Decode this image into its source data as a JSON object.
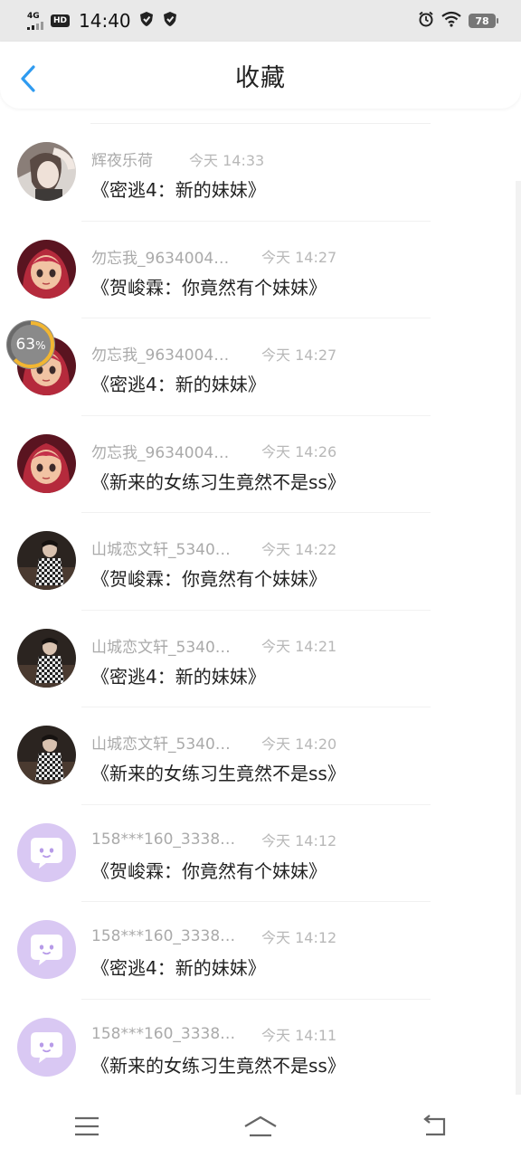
{
  "status_bar": {
    "network": "4G",
    "hd": "HD",
    "time": "14:40",
    "battery": "78"
  },
  "header": {
    "title": "收藏"
  },
  "progress_badge": {
    "value": "63",
    "unit": "%"
  },
  "items": [
    {
      "name": "辉夜乐荷",
      "time": "今天 14:33",
      "title": "《密逃4：新的妹妹》",
      "avatar": "photo-girl"
    },
    {
      "name": "勿忘我_9634004…",
      "time": "今天 14:27",
      "title": "《贺峻霖：你竟然有个妹妹》",
      "avatar": "anime-red-hair"
    },
    {
      "name": "勿忘我_9634004…",
      "time": "今天 14:27",
      "title": "《密逃4：新的妹妹》",
      "avatar": "anime-red-hair"
    },
    {
      "name": "勿忘我_9634004…",
      "time": "今天 14:26",
      "title": "《新来的女练习生竟然不是ss》",
      "avatar": "anime-red-hair"
    },
    {
      "name": "山城恋文轩_5340…",
      "time": "今天 14:22",
      "title": "《贺峻霖：你竟然有个妹妹》",
      "avatar": "photo-dark-checkered"
    },
    {
      "name": "山城恋文轩_5340…",
      "time": "今天 14:21",
      "title": "《密逃4：新的妹妹》",
      "avatar": "photo-dark-checkered"
    },
    {
      "name": "山城恋文轩_5340…",
      "time": "今天 14:20",
      "title": "《新来的女练习生竟然不是ss》",
      "avatar": "photo-dark-checkered"
    },
    {
      "name": "158***160_3338…",
      "time": "今天 14:12",
      "title": "《贺峻霖：你竟然有个妹妹》",
      "avatar": "default-chat-bubble"
    },
    {
      "name": "158***160_3338…",
      "time": "今天 14:12",
      "title": "《密逃4：新的妹妹》",
      "avatar": "default-chat-bubble"
    },
    {
      "name": "158***160_3338…",
      "time": "今天 14:11",
      "title": "《新来的女练习生竟然不是ss》",
      "avatar": "default-chat-bubble"
    }
  ],
  "colors": {
    "accent": "#2f9bf0",
    "avatar_default_bg": "#d9c8f3"
  }
}
